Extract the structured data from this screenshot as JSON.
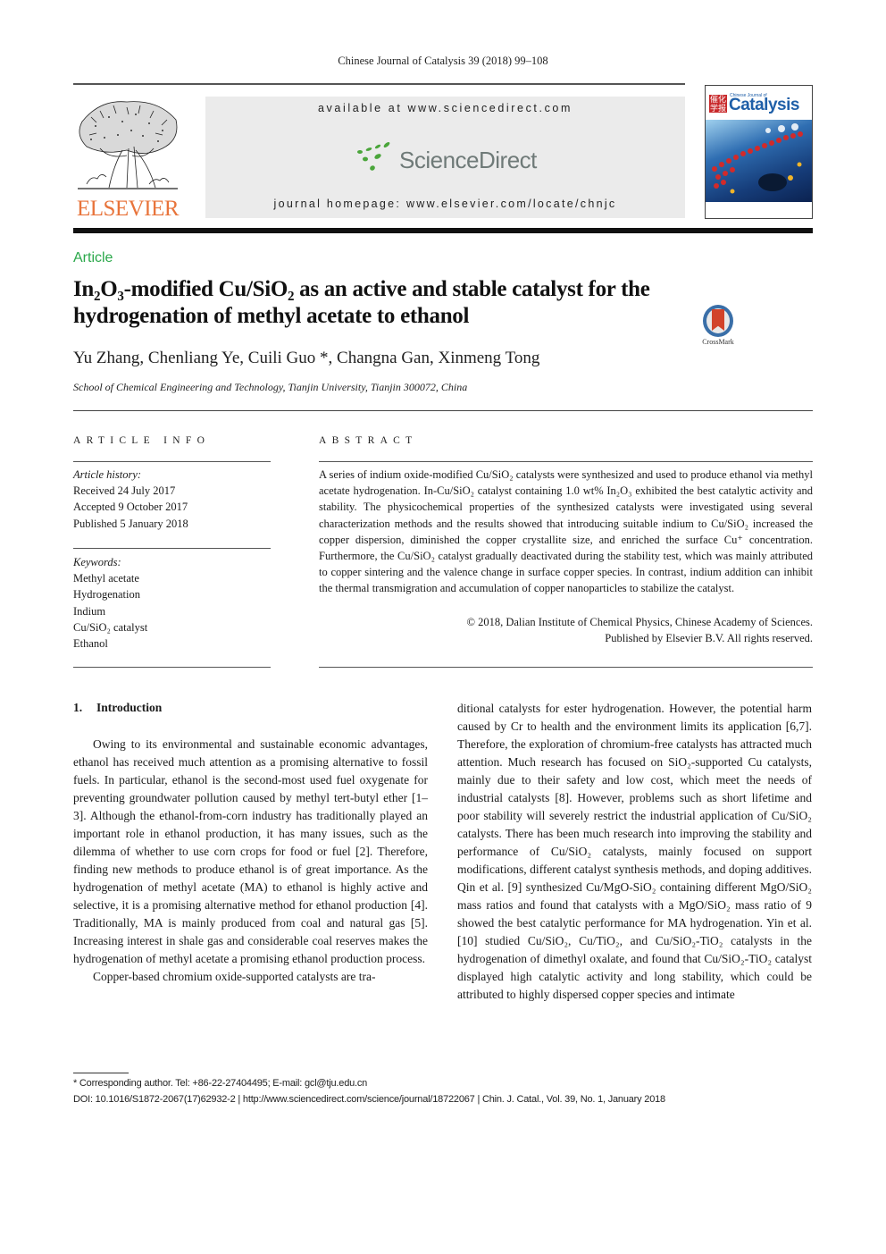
{
  "running_header": "Chinese Journal of Catalysis 39 (2018) 99–108",
  "publisher": {
    "logo_word": "ELSEVIER",
    "logo_color": "#e8743b"
  },
  "banner": {
    "available_at": "available at www.sciencedirect.com",
    "sciencedirect_logo": "ScienceDirect",
    "logo_leaf_color": "#4aa53a",
    "journal_homepage": "journal homepage: www.elsevier.com/locate/chnjc"
  },
  "cover": {
    "small_title": "Chinese Journal of",
    "title": "Catalysis",
    "seal": "催化学报"
  },
  "article": {
    "type_label": "Article",
    "type_color": "#2aa84a",
    "title_line1": "In₂O₃-modified Cu/SiO₂ as an active and stable catalyst for the",
    "title_line2": "hydrogenation of methyl acetate to ethanol",
    "crossmark_label": "CrossMark",
    "authors": "Yu Zhang, Chenliang Ye, Cuili Guo *, Changna Gan, Xinmeng Tong",
    "affiliation": "School of Chemical Engineering and Technology, Tianjin University, Tianjin 300072, China"
  },
  "article_info": {
    "heading": "ARTICLE INFO",
    "history_label": "Article history:",
    "history": [
      "Received 24 July 2017",
      "Accepted 9 October 2017",
      "Published 5 January 2018"
    ],
    "keywords_label": "Keywords:",
    "keywords": [
      "Methyl acetate",
      "Hydrogenation",
      "Indium",
      "Cu/SiO₂ catalyst",
      "Ethanol"
    ]
  },
  "abstract": {
    "heading": "ABSTRACT",
    "text": "A series of indium oxide-modified Cu/SiO₂ catalysts were synthesized and used to produce ethanol via methyl acetate hydrogenation. In-Cu/SiO₂ catalyst containing 1.0 wt% In₂O₃ exhibited the best catalytic activity and stability. The physicochemical properties of the synthesized catalysts were investigated using several characterization methods and the results showed that introducing suitable indium to Cu/SiO₂ increased the copper dispersion, diminished the copper crystallite size, and enriched the surface Cu⁺ concentration. Furthermore, the Cu/SiO₂ catalyst gradually deactivated during the stability test, which was mainly attributed to copper sintering and the valence change in surface copper species. In contrast, indium addition can inhibit the thermal transmigration and accumulation of copper nanoparticles to stabilize the catalyst.",
    "copyright_line1": "© 2018, Dalian Institute of Chemical Physics, Chinese Academy of Sciences.",
    "copyright_line2": "Published by Elsevier B.V. All rights reserved."
  },
  "body": {
    "section_number": "1.",
    "section_title": "Introduction",
    "left_paragraphs": [
      "Owing to its environmental and sustainable economic advantages, ethanol has received much attention as a promising alternative to fossil fuels. In particular, ethanol is the second-most used fuel oxygenate for preventing groundwater pollution caused by methyl tert-butyl ether [1–3]. Although the ethanol-from-corn industry has traditionally played an important role in ethanol production, it has many issues, such as the dilemma of whether to use corn crops for food or fuel [2]. Therefore, finding new methods to produce ethanol is of great importance. As the hydrogenation of methyl acetate (MA) to ethanol is highly active and selective, it is a promising alternative method for ethanol production [4]. Traditionally, MA is mainly produced from coal and natural gas [5]. Increasing interest in shale gas and considerable coal reserves makes the hydrogenation of methyl acetate a promising ethanol production process.",
      "Copper-based chromium oxide-supported catalysts are tra-"
    ],
    "right_paragraph": "ditional catalysts for ester hydrogenation. However, the potential harm caused by Cr to health and the environment limits its application [6,7]. Therefore, the exploration of chromium-free catalysts has attracted much attention. Much research has focused on SiO₂-supported Cu catalysts, mainly due to their safety and low cost, which meet the needs of industrial catalysts [8]. However, problems such as short lifetime and poor stability will severely restrict the industrial application of Cu/SiO₂ catalysts. There has been much research into improving the stability and performance of Cu/SiO₂ catalysts, mainly focused on support modifications, different catalyst synthesis methods, and doping additives. Qin et al. [9] synthesized Cu/MgO-SiO₂ containing different MgO/SiO₂ mass ratios and found that catalysts with a MgO/SiO₂ mass ratio of 9 showed the best catalytic performance for MA hydrogenation. Yin et al. [10] studied Cu/SiO₂, Cu/TiO₂, and Cu/SiO₂-TiO₂ catalysts in the hydrogenation of dimethyl oxalate, and found that Cu/SiO₂-TiO₂ catalyst displayed high catalytic activity and long stability, which could be attributed to highly dispersed copper species and intimate"
  },
  "footer": {
    "corresponding": "* Corresponding author. Tel: +86-22-27404495; E-mail: gcl@tju.edu.cn",
    "doi_line": "DOI: 10.1016/S1872-2067(17)62932-2 | http://www.sciencedirect.com/science/journal/18722067 | Chin. J. Catal., Vol. 39, No. 1, January 2018"
  }
}
